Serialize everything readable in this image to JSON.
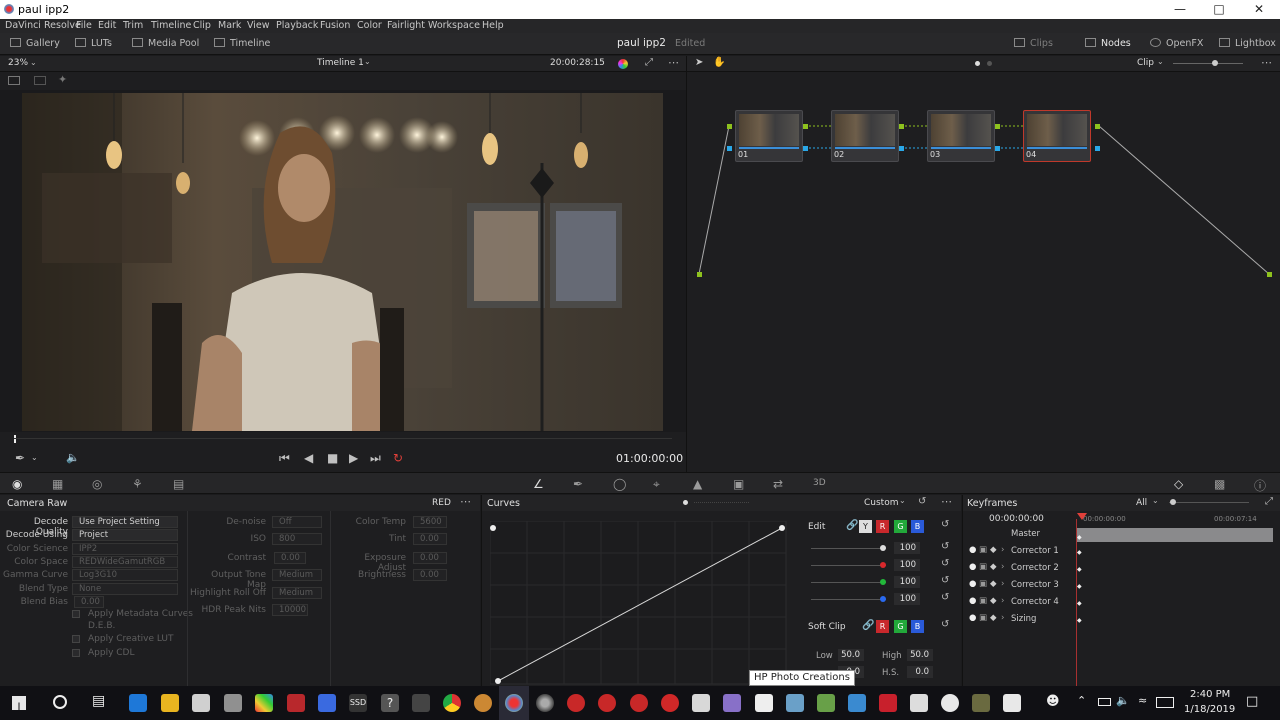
{
  "window": {
    "title": "paul ipp2"
  },
  "menu": [
    "DaVinci Resolve",
    "File",
    "Edit",
    "Trim",
    "Timeline",
    "Clip",
    "Mark",
    "View",
    "Playback",
    "Fusion",
    "Color",
    "Fairlight",
    "Workspace",
    "Help"
  ],
  "toolbar": {
    "left": [
      "Gallery",
      "LUTs",
      "Media Pool",
      "Timeline"
    ],
    "project": "paul ipp2",
    "status": "Edited",
    "right": [
      "Clips",
      "Nodes",
      "OpenFX",
      "Lightbox"
    ]
  },
  "viewer": {
    "zoom": "23%",
    "timeline_name": "Timeline 1",
    "timecode_top": "20:00:28:15",
    "timecode": "01:00:00:00"
  },
  "node_editor": {
    "mode": "Clip",
    "nodes": [
      "01",
      "02",
      "03",
      "04"
    ]
  },
  "camera_raw": {
    "title": "Camera Raw",
    "format": "RED",
    "col1": [
      {
        "label": "Decode Quality",
        "value": "Use Project Setting",
        "active": true
      },
      {
        "label": "Decode Using",
        "value": "Project",
        "active": true
      },
      {
        "label": "Color Science",
        "value": "IPP2",
        "active": false
      },
      {
        "label": "Color Space",
        "value": "REDWideGamutRGB",
        "active": false
      },
      {
        "label": "Gamma Curve",
        "value": "Log3G10",
        "active": false
      },
      {
        "label": "Blend Type",
        "value": "None",
        "active": false
      },
      {
        "label": "Blend Bias",
        "value": "0.00",
        "active": false
      }
    ],
    "checks": [
      "Apply Metadata Curves",
      "D.E.B.",
      "Apply Creative LUT",
      "Apply CDL"
    ],
    "col2": [
      {
        "label": "De-noise",
        "value": "Off"
      },
      {
        "label": "ISO",
        "value": "800"
      },
      {
        "label": "Contrast",
        "value": "0.00"
      },
      {
        "label": "Output Tone Map",
        "value": "Medium"
      },
      {
        "label": "Highlight Roll Off",
        "value": "Medium"
      },
      {
        "label": "HDR Peak Nits",
        "value": "10000"
      }
    ],
    "col3": [
      {
        "label": "Color Temp",
        "value": "5600"
      },
      {
        "label": "Tint",
        "value": "0.00"
      },
      {
        "label": "Exposure Adjust",
        "value": "0.00"
      },
      {
        "label": "Brightness",
        "value": "0.00"
      }
    ]
  },
  "curves": {
    "title": "Curves",
    "preset": "Custom",
    "edit_label": "Edit",
    "channels": [
      "Y",
      "R",
      "G",
      "B"
    ],
    "values": [
      "100",
      "100",
      "100",
      "100"
    ],
    "soft_clip": "Soft Clip",
    "low_label": "Low",
    "low_value": "50.0",
    "high_label": "High",
    "high_value": "50.0",
    "ls_value": "0.0",
    "hs_label": "H.S.",
    "hs_value": "0.0"
  },
  "keyframes": {
    "title": "Keyframes",
    "filter": "All",
    "timecode": "00:00:00:00",
    "ruler_start": "00:00:00:00",
    "ruler_end": "00:00:07:14",
    "rows": [
      "Master",
      "Corrector 1",
      "Corrector 2",
      "Corrector 3",
      "Corrector 4",
      "Sizing"
    ]
  },
  "taskbar": {
    "tooltip": "HP Photo Creations",
    "time": "2:40 PM",
    "date": "1/18/2019"
  },
  "colors": {
    "accent_green": "#8ec21e",
    "accent_blue": "#2aa8e8",
    "selected_node": "#c0392b",
    "playhead": "#e0403a"
  }
}
